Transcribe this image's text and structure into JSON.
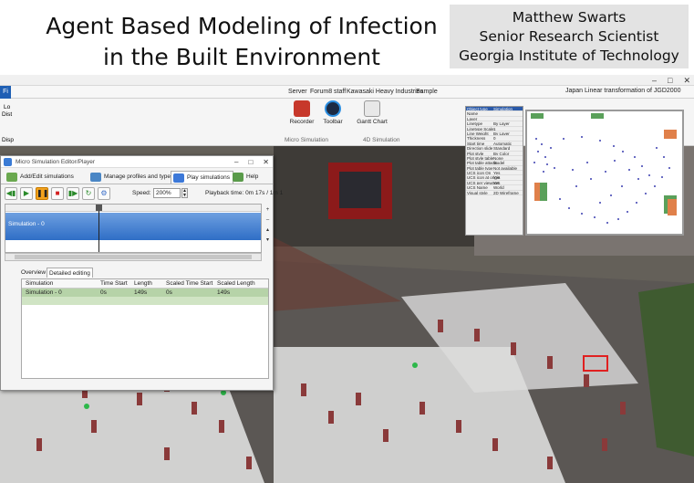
{
  "slide": {
    "title_lines": [
      "Agent Based Modeling of Infection",
      "in the Built Environment"
    ],
    "author_lines": [
      "Matthew Swarts",
      "Senior Research Scientist",
      "Georgia Institute of Technology"
    ]
  },
  "app": {
    "file_tab": "Fi",
    "menu": [
      "Server",
      "Forum8 staff",
      "Kawasaki Heavy Industries",
      "Sample"
    ],
    "menu_right": "Japan   Linear transformation of JGD2000",
    "ribbon_buttons": [
      "Recorder",
      "Toolbar",
      "Gantt Chart"
    ],
    "ribbon_groups": [
      "Micro Simulation",
      "4D Simulation"
    ],
    "left_labels": [
      "Lo",
      "Dist",
      "Disp"
    ],
    "colors": {
      "file_tab": "#1e5fb4",
      "timeline": "#2f6ec6",
      "grid_row": "#b6d3a8"
    }
  },
  "sim_window": {
    "title": "Micro Simulation Editor/Player",
    "tabs": [
      {
        "label": "Add/Edit simulations",
        "icon": "add-simulation-icon"
      },
      {
        "label": "Manage profiles and types",
        "icon": "profiles-icon"
      },
      {
        "label": "Play simulations",
        "icon": "play-simulation-icon"
      },
      {
        "label": "Help",
        "icon": "help-icon"
      }
    ],
    "speed_label": "Speed:",
    "speed_value": "200%",
    "playback_time": "Playback time: 0m 17s / 1m 1",
    "timeline_bar_label": "Simulation - 0",
    "sub_tabs": [
      "Overview",
      "Detailed editing"
    ],
    "grid_columns": [
      "Simulation",
      "Time Start",
      "Length",
      "Scaled Time Start",
      "Scaled Length"
    ],
    "grid_rows": [
      [
        "Simulation - 0",
        "0s",
        "149s",
        "0s",
        "149s"
      ]
    ]
  },
  "properties": {
    "header": [
      "Object type",
      "Simulation"
    ],
    "rows": [
      [
        "Name",
        ""
      ],
      [
        "Layer",
        ""
      ],
      [
        "Linetype",
        "By Layer"
      ],
      [
        "Linetype Scale",
        "1"
      ],
      [
        "Line Weight",
        "By Layer"
      ],
      [
        "Thickness",
        "0"
      ],
      [
        "Start time",
        "Automatic"
      ],
      [
        "Direction slide",
        "Standard"
      ],
      [
        "Plot style",
        "By Color"
      ],
      [
        "Plot style table",
        "None"
      ],
      [
        "Plot table attach.",
        "Model"
      ],
      [
        "Plot table type",
        "Not available"
      ],
      [
        "UCS icon On",
        "Yes"
      ],
      [
        "UCS icon at origin",
        "Yes"
      ],
      [
        "UCS per viewport",
        "Yes"
      ],
      [
        "UCS Name",
        "World"
      ],
      [
        "Visual style",
        "2D Wireframe"
      ]
    ]
  }
}
